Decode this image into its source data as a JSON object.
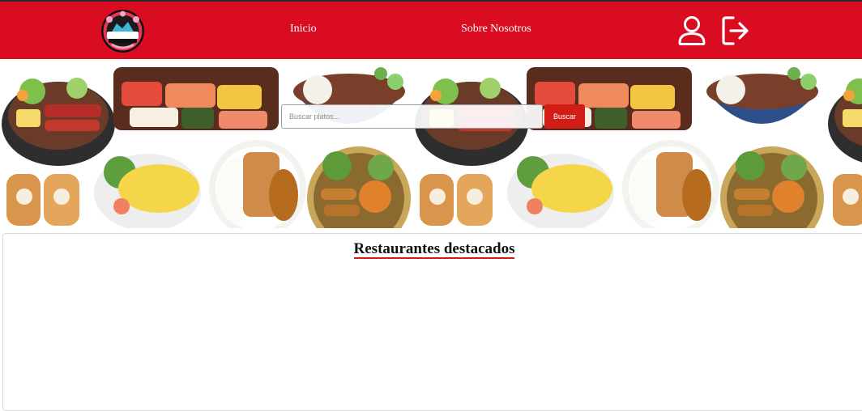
{
  "header": {
    "logo_alt_text": "SAKURA",
    "nav": {
      "inicio": "Inicio",
      "sobre": "Sobre Nosotros"
    },
    "icons": [
      "user-icon",
      "logout-icon"
    ]
  },
  "hero": {
    "search": {
      "placeholder": "Buscar platos...",
      "value": "",
      "button_label": "Buscar"
    }
  },
  "featured": {
    "title": "Restaurantes destacados"
  },
  "colors": {
    "brand_red": "#d90c22",
    "search_button": "#d21d16",
    "title_underline": "#d91818"
  }
}
